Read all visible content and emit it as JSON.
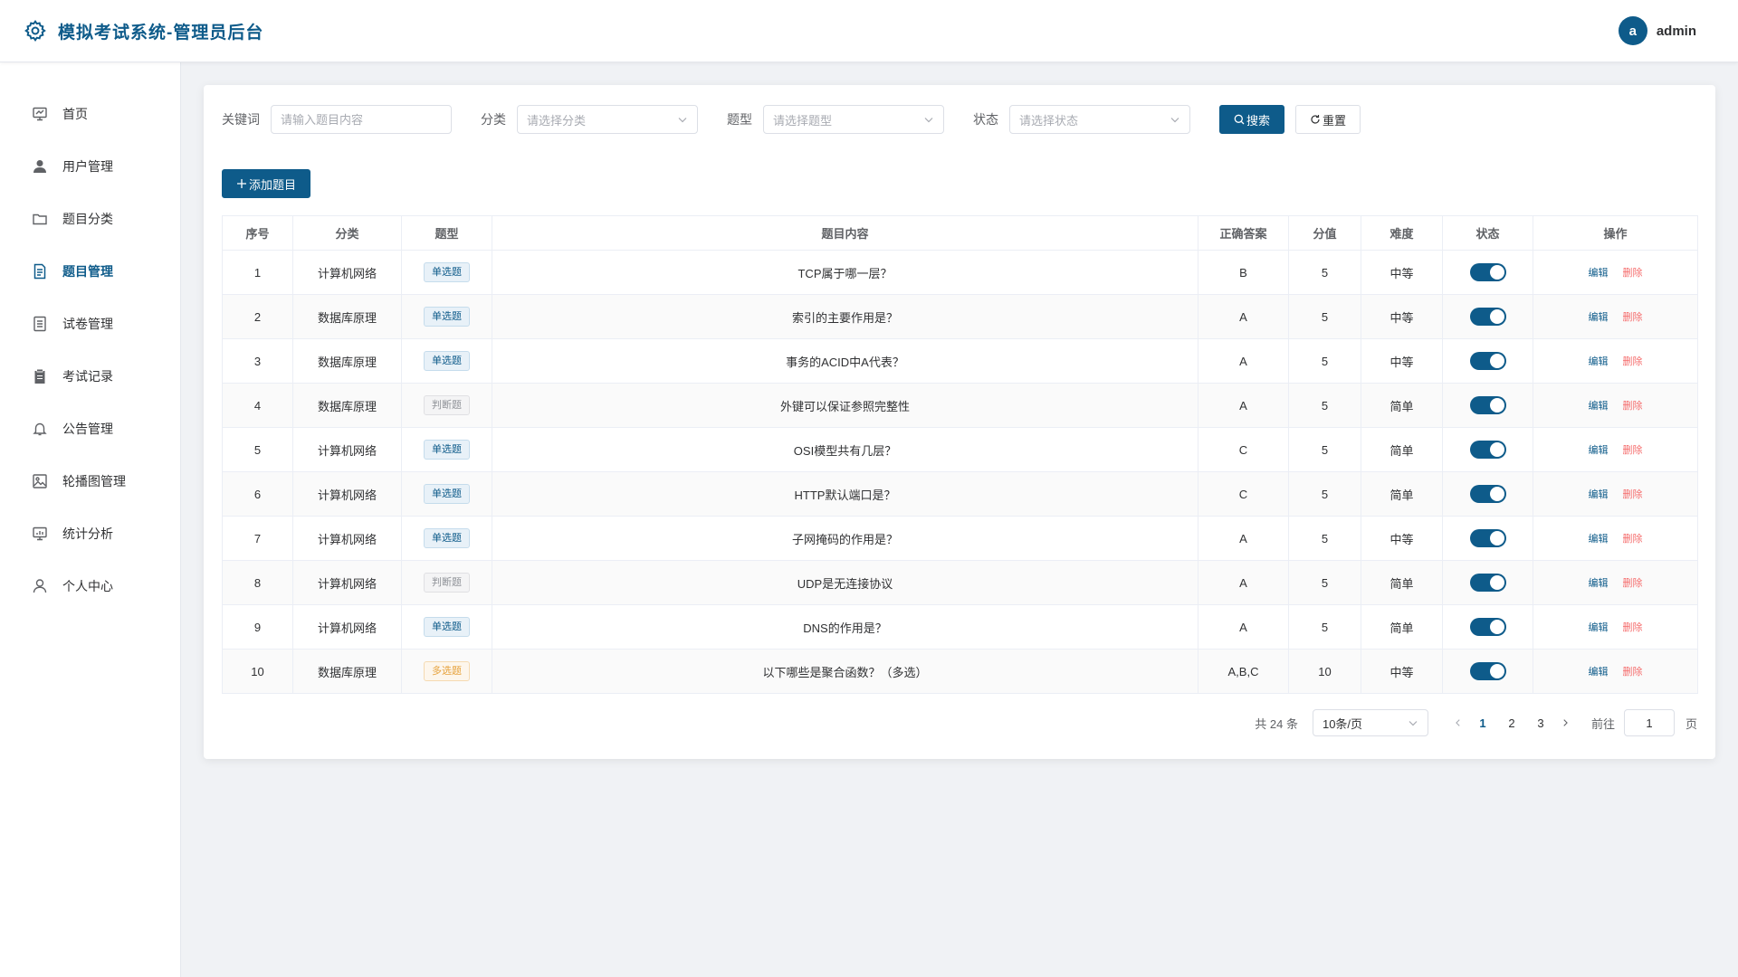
{
  "header": {
    "title": "模拟考试系统-管理员后台",
    "avatar_letter": "a",
    "username": "admin"
  },
  "sidebar": {
    "items": [
      {
        "label": "首页",
        "icon": "home-screen-icon"
      },
      {
        "label": "用户管理",
        "icon": "user-icon"
      },
      {
        "label": "题目分类",
        "icon": "folder-icon"
      },
      {
        "label": "题目管理",
        "icon": "document-icon",
        "active": true
      },
      {
        "label": "试卷管理",
        "icon": "paper-icon"
      },
      {
        "label": "考试记录",
        "icon": "clipboard-icon"
      },
      {
        "label": "公告管理",
        "icon": "bell-icon"
      },
      {
        "label": "轮播图管理",
        "icon": "picture-icon"
      },
      {
        "label": "统计分析",
        "icon": "chart-screen-icon"
      },
      {
        "label": "个人中心",
        "icon": "person-outline-icon"
      }
    ]
  },
  "filters": {
    "keyword_label": "关键词",
    "keyword_placeholder": "请输入题目内容",
    "category_label": "分类",
    "category_placeholder": "请选择分类",
    "type_label": "题型",
    "type_placeholder": "请选择题型",
    "status_label": "状态",
    "status_placeholder": "请选择状态",
    "search_label": "搜索",
    "reset_label": "重置"
  },
  "add_button": "添加题目",
  "table": {
    "columns": [
      "序号",
      "分类",
      "题型",
      "题目内容",
      "正确答案",
      "分值",
      "难度",
      "状态",
      "操作"
    ],
    "edit_label": "编辑",
    "delete_label": "删除",
    "rows": [
      {
        "no": "1",
        "category": "计算机网络",
        "type": "单选题",
        "type_kind": "single",
        "content": "TCP属于哪一层？",
        "answer": "B",
        "score": "5",
        "difficulty": "中等",
        "enabled": true
      },
      {
        "no": "2",
        "category": "数据库原理",
        "type": "单选题",
        "type_kind": "single",
        "content": "索引的主要作用是？",
        "answer": "A",
        "score": "5",
        "difficulty": "中等",
        "enabled": true
      },
      {
        "no": "3",
        "category": "数据库原理",
        "type": "单选题",
        "type_kind": "single",
        "content": "事务的ACID中A代表？",
        "answer": "A",
        "score": "5",
        "difficulty": "中等",
        "enabled": true
      },
      {
        "no": "4",
        "category": "数据库原理",
        "type": "判断题",
        "type_kind": "judge",
        "content": "外键可以保证参照完整性",
        "answer": "A",
        "score": "5",
        "difficulty": "简单",
        "enabled": true
      },
      {
        "no": "5",
        "category": "计算机网络",
        "type": "单选题",
        "type_kind": "single",
        "content": "OSI模型共有几层？",
        "answer": "C",
        "score": "5",
        "difficulty": "简单",
        "enabled": true
      },
      {
        "no": "6",
        "category": "计算机网络",
        "type": "单选题",
        "type_kind": "single",
        "content": "HTTP默认端口是？",
        "answer": "C",
        "score": "5",
        "difficulty": "简单",
        "enabled": true
      },
      {
        "no": "7",
        "category": "计算机网络",
        "type": "单选题",
        "type_kind": "single",
        "content": "子网掩码的作用是？",
        "answer": "A",
        "score": "5",
        "difficulty": "中等",
        "enabled": true
      },
      {
        "no": "8",
        "category": "计算机网络",
        "type": "判断题",
        "type_kind": "judge",
        "content": "UDP是无连接协议",
        "answer": "A",
        "score": "5",
        "difficulty": "简单",
        "enabled": true
      },
      {
        "no": "9",
        "category": "计算机网络",
        "type": "单选题",
        "type_kind": "single",
        "content": "DNS的作用是？",
        "answer": "A",
        "score": "5",
        "difficulty": "简单",
        "enabled": true
      },
      {
        "no": "10",
        "category": "数据库原理",
        "type": "多选题",
        "type_kind": "multi",
        "content": "以下哪些是聚合函数？（多选）",
        "answer": "A,B,C",
        "score": "10",
        "difficulty": "中等",
        "enabled": true
      }
    ]
  },
  "pagination": {
    "total_text": "共 24 条",
    "page_size": "10条/页",
    "pages": [
      "1",
      "2",
      "3"
    ],
    "current_page": "1",
    "goto_label": "前往",
    "goto_value": "1",
    "goto_suffix": "页"
  },
  "colors": {
    "primary": "#0e5b8a",
    "danger": "#f56c6c",
    "warning": "#e6a23c"
  }
}
